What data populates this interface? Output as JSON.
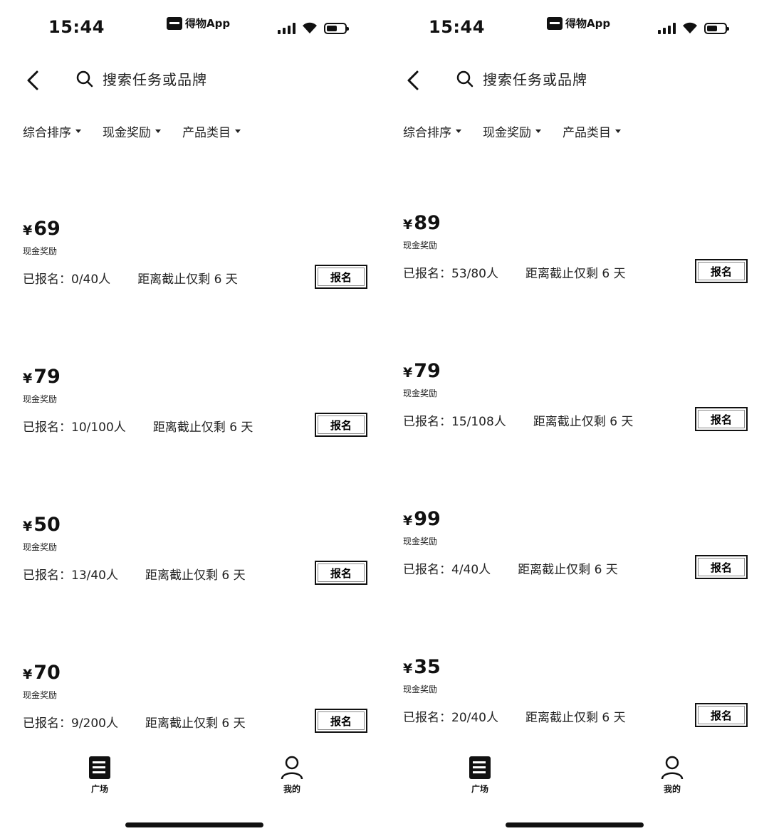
{
  "screens": [
    {
      "status": {
        "time": "15:44",
        "app_label": "得物App"
      },
      "search": {
        "placeholder": "搜索任务或品牌"
      },
      "filters": [
        "综合排序",
        "现金奖励",
        "产品类目"
      ],
      "tasks": [
        {
          "price": "69",
          "reward_label": "现金奖励",
          "enrolled": "已报名：0/40人",
          "deadline": "距离截止仅剩 6 天",
          "button": "报名"
        },
        {
          "price": "79",
          "reward_label": "现金奖励",
          "enrolled": "已报名：10/100人",
          "deadline": "距离截止仅剩 6 天",
          "button": "报名"
        },
        {
          "price": "50",
          "reward_label": "现金奖励",
          "enrolled": "已报名：13/40人",
          "deadline": "距离截止仅剩 6 天",
          "button": "报名"
        },
        {
          "price": "70",
          "reward_label": "现金奖励",
          "enrolled": "已报名：9/200人",
          "deadline": "距离截止仅剩 6 天",
          "button": "报名"
        }
      ],
      "tabs": {
        "square": "广场",
        "mine": "我的"
      }
    },
    {
      "status": {
        "time": "15:44",
        "app_label": "得物App"
      },
      "search": {
        "placeholder": "搜索任务或品牌"
      },
      "filters": [
        "综合排序",
        "现金奖励",
        "产品类目"
      ],
      "tasks": [
        {
          "price": "89",
          "reward_label": "现金奖励",
          "enrolled": "已报名：53/80人",
          "deadline": "距离截止仅剩 6 天",
          "button": "报名"
        },
        {
          "price": "79",
          "reward_label": "现金奖励",
          "enrolled": "已报名：15/108人",
          "deadline": "距离截止仅剩 6 天",
          "button": "报名"
        },
        {
          "price": "99",
          "reward_label": "现金奖励",
          "enrolled": "已报名：4/40人",
          "deadline": "距离截止仅剩 6 天",
          "button": "报名"
        },
        {
          "price": "35",
          "reward_label": "现金奖励",
          "enrolled": "已报名：20/40人",
          "deadline": "距离截止仅剩 6 天",
          "button": "报名"
        }
      ],
      "tabs": {
        "square": "广场",
        "mine": "我的"
      }
    }
  ],
  "currency_symbol": "¥",
  "icons": [
    "back-chevron-icon",
    "search-icon",
    "caret-down-icon",
    "square-list-icon",
    "person-icon"
  ]
}
